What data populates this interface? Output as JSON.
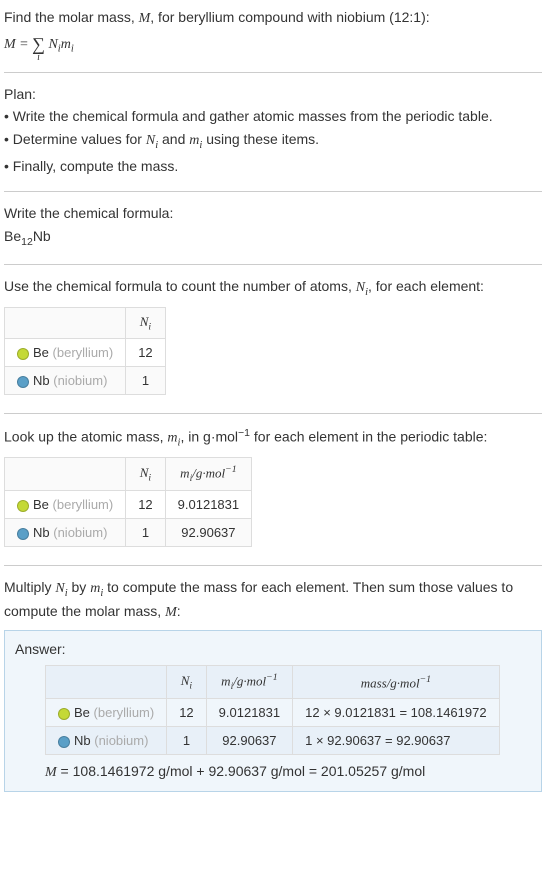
{
  "intro": {
    "line1": "Find the molar mass, M, for beryllium compound with niobium (12:1):",
    "formula_lhs": "M = ",
    "formula_rhs": " N",
    "formula_sub1": "i",
    "formula_rhs2": "m",
    "formula_sub2": "i"
  },
  "plan": {
    "title": "Plan:",
    "bullet1": "• Write the chemical formula and gather atomic masses from the periodic table.",
    "bullet2_a": "• Determine values for ",
    "bullet2_n": "N",
    "bullet2_ni": "i",
    "bullet2_b": " and ",
    "bullet2_m": "m",
    "bullet2_mi": "i",
    "bullet2_c": " using these items.",
    "bullet3": "• Finally, compute the mass."
  },
  "formula_section": {
    "title": "Write the chemical formula:",
    "formula_a": "Be",
    "formula_sub": "12",
    "formula_b": "Nb"
  },
  "count_section": {
    "title_a": "Use the chemical formula to count the number of atoms, ",
    "title_n": "N",
    "title_ni": "i",
    "title_b": ", for each element:",
    "header_n": "N",
    "header_ni": "i"
  },
  "elements": [
    {
      "symbol": "Be",
      "name": "(beryllium)",
      "color": "#c4d936",
      "ni": "12",
      "mi": "9.0121831"
    },
    {
      "symbol": "Nb",
      "name": "(niobium)",
      "color": "#5a9fc7",
      "ni": "1",
      "mi": "92.90637"
    }
  ],
  "mass_section": {
    "title_a": "Look up the atomic mass, ",
    "title_m": "m",
    "title_mi": "i",
    "title_b": ", in g·mol",
    "title_exp": "−1",
    "title_c": " for each element in the periodic table:",
    "header_n": "N",
    "header_ni": "i",
    "header_m": "m",
    "header_mi": "i",
    "header_unit": "/g·mol",
    "header_exp": "−1"
  },
  "multiply_section": {
    "text_a": "Multiply ",
    "text_n": "N",
    "text_ni": "i",
    "text_b": " by ",
    "text_m": "m",
    "text_mi": "i",
    "text_c": " to compute the mass for each element. Then sum those values to compute the molar mass, ",
    "text_M": "M",
    "text_d": ":"
  },
  "answer": {
    "title": "Answer:",
    "header_n": "N",
    "header_ni": "i",
    "header_m": "m",
    "header_mi": "i",
    "header_unit": "/g·mol",
    "header_exp": "−1",
    "header_mass": "mass/g·mol",
    "header_mass_exp": "−1",
    "rows": [
      {
        "mass_calc": "12 × 9.0121831 = 108.1461972"
      },
      {
        "mass_calc": "1 × 92.90637 = 92.90637"
      }
    ],
    "final_a": "M",
    "final_b": " = 108.1461972 g/mol + 92.90637 g/mol = 201.05257 g/mol"
  }
}
